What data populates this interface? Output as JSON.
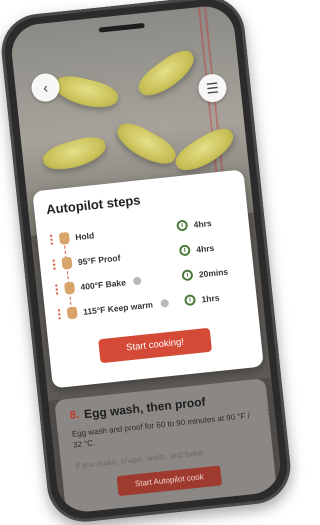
{
  "nav": {
    "back_icon": "chevron-left-icon",
    "menu_icon": "list-icon"
  },
  "autopilot": {
    "title": "Autopilot steps",
    "steps": [
      {
        "label": "Hold",
        "time": "4hrs"
      },
      {
        "label": "95°F Proof",
        "time": "4hrs"
      },
      {
        "label": "400°F Bake",
        "time": "20mins"
      },
      {
        "label": "115°F Keep warm",
        "time": "1hrs"
      }
    ],
    "start_label": "Start cooking!"
  },
  "recipe_step": {
    "number": "8.",
    "heading": "Egg wash, then proof",
    "description": "Egg wash and proof for 60 to 90 minutes at 90 °F / 32 °C.",
    "note": "If you make, shape, wash, and bake",
    "button_label": "Start Autopilot cook"
  },
  "colors": {
    "accent": "#d44a36",
    "clock": "#4c7a3a"
  }
}
